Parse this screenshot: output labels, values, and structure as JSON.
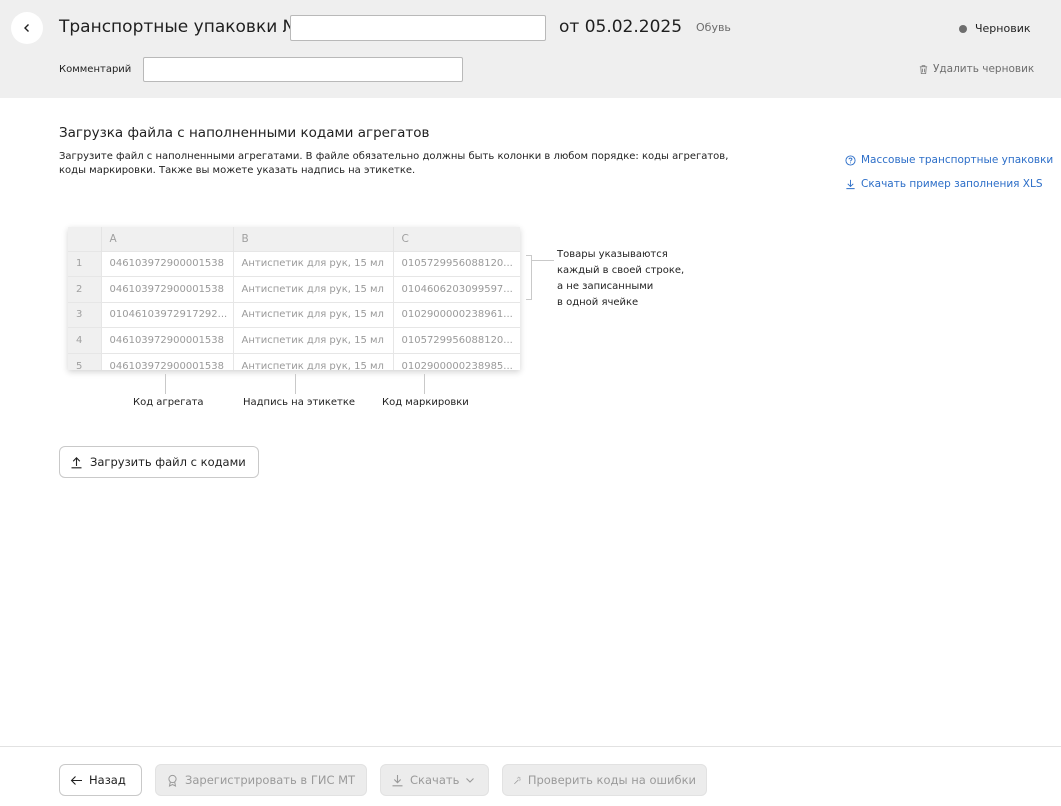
{
  "header": {
    "title": "Транспортные упаковки №",
    "number_value": "",
    "date": "от 05.02.2025",
    "category": "Обувь",
    "status": "Черновик",
    "status_color": "#6e6e6e",
    "comment_label": "Комментарий",
    "comment_value": "",
    "delete_label": "Удалить черновик"
  },
  "main": {
    "section_title": "Загрузка файла с наполненными кодами агрегатов",
    "description": "Загрузите файл с наполненными агрегатами. В файле обязательно должны быть колонки в любом порядке: коды агрегатов, коды маркировки. Также вы можете указать надпись на этикетке.",
    "links": [
      {
        "label": "Массовые транспортные упаковки",
        "icon": "help-circle-icon"
      },
      {
        "label": "Скачать пример заполнения XLS",
        "icon": "download-icon"
      }
    ],
    "link_color": "#2c6ec8",
    "example": {
      "columns": [
        "A",
        "B",
        "C"
      ],
      "rows": [
        {
          "n": "1",
          "a": "046103972900001538",
          "b": "Антиспетик для рук, 15 мл",
          "c": "0105729956088120..."
        },
        {
          "n": "2",
          "a": "046103972900001538",
          "b": "Антиспетик для рук, 15 мл",
          "c": "0104606203099597..."
        },
        {
          "n": "3",
          "a": "01046103972917292...",
          "b": "Антиспетик для рук, 15 мл",
          "c": "0102900000238961..."
        },
        {
          "n": "4",
          "a": "046103972900001538",
          "b": "Антиспетик для рук, 15 мл",
          "c": "0105729956088120..."
        },
        {
          "n": "5",
          "a": "046103972900001538",
          "b": "Антиспетик для рук, 15 мл",
          "c": "0102900000238985..."
        }
      ],
      "note": "Товары указываются каждый в своей строке, а не записанными в одной ячейке",
      "note_lines": [
        "Товары указываются",
        "каждый в своей строке,",
        "а не записанными",
        "в одной ячейке"
      ],
      "column_labels": [
        "Код агрегата",
        "Надпись на этикетке",
        "Код маркировки"
      ]
    },
    "upload_label": "Загрузить файл с кодами"
  },
  "footer": {
    "back_label": "Назад",
    "register_label": "Зарегистрировать в ГИС МТ",
    "download_label": "Скачать",
    "check_label": "Проверить коды на ошибки"
  }
}
